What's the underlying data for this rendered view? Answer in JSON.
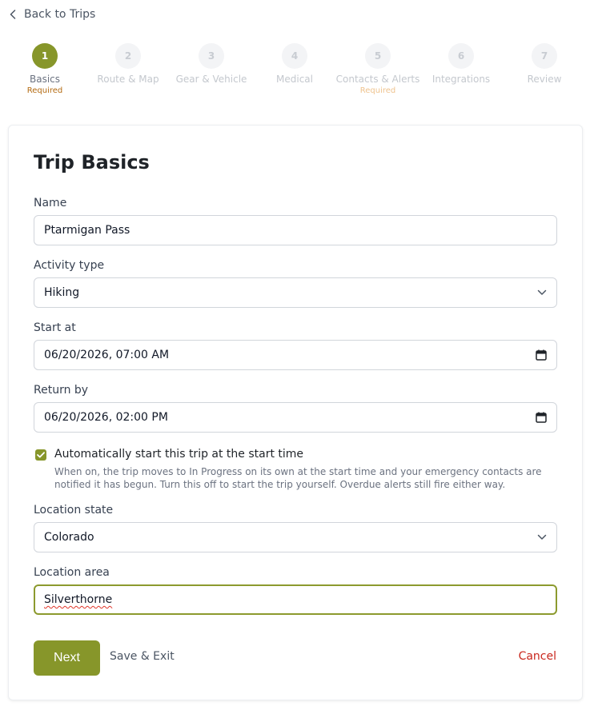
{
  "nav": {
    "back_label": "Back to Trips"
  },
  "stepper": {
    "steps": [
      {
        "number": "1",
        "label": "Basics",
        "required": "Required"
      },
      {
        "number": "2",
        "label": "Route & Map",
        "required": ""
      },
      {
        "number": "3",
        "label": "Gear & Vehicle",
        "required": ""
      },
      {
        "number": "4",
        "label": "Medical",
        "required": ""
      },
      {
        "number": "5",
        "label": "Contacts & Alerts",
        "required": "Required"
      },
      {
        "number": "6",
        "label": "Integrations",
        "required": ""
      },
      {
        "number": "7",
        "label": "Review",
        "required": ""
      }
    ]
  },
  "form": {
    "title": "Trip Basics",
    "name": {
      "label": "Name",
      "value": "Ptarmigan Pass"
    },
    "activity_type": {
      "label": "Activity type",
      "value": "Hiking"
    },
    "start_at": {
      "label": "Start at",
      "value": "06/20/2026, 07:00 AM"
    },
    "return_by": {
      "label": "Return by",
      "value": "06/20/2026, 02:00 PM"
    },
    "auto_start": {
      "label": "Automatically start this trip at the start time",
      "help": "When on, the trip moves to In Progress on its own at the start time and your emergency contacts are notified it has begun. Turn this off to start the trip yourself. Overdue alerts still fire either way.",
      "checked": true
    },
    "location_state": {
      "label": "Location state",
      "value": "Colorado"
    },
    "location_area": {
      "label": "Location area",
      "value": "Silverthorne"
    }
  },
  "actions": {
    "next_label": "Next",
    "save_exit_label": "Save & Exit",
    "cancel_label": "Cancel"
  },
  "colors": {
    "accent": "#87962a",
    "required_text": "#b46b12",
    "cancel_text": "#c9261c"
  }
}
